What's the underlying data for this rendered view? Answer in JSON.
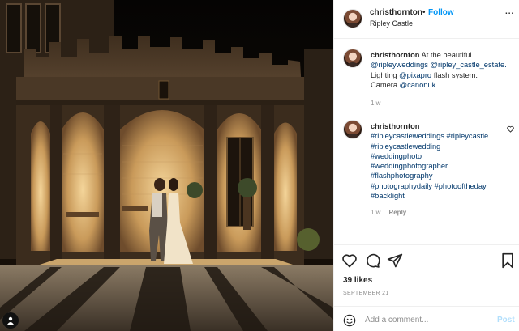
{
  "post": {
    "username": "christhornton",
    "follow_separator": "•",
    "follow_label": "Follow",
    "location": "Ripley Castle",
    "more_label": "..."
  },
  "caption": {
    "username": "christhornton",
    "text_before": " At the beautiful",
    "tags": [
      "@ripleyweddings",
      "@ripley_castle_estate."
    ],
    "text_lighting": "Lighting",
    "pixapro": "@pixapro",
    "text_flash": "flash system.",
    "text_camera": "Camera",
    "canon": "@canonuk",
    "time": "1 w"
  },
  "comment": {
    "username": "christhornton",
    "hashtags": [
      "#ripleycastleweddings #ripleycastle",
      "#ripleycastlewedding",
      "#weddingphoto",
      "#weddingphotographer",
      "#flashphotography",
      "#photographydaily #photooftheday",
      "#backlight"
    ],
    "time": "1 w",
    "reply_label": "Reply"
  },
  "stats": {
    "likes": "39 likes",
    "date": "SEPTEMBER 21"
  },
  "add_comment": {
    "placeholder": "Add a comment...",
    "post_label": "Post"
  },
  "icons": {
    "like": "heart-icon",
    "comment": "comment-icon",
    "share": "share-icon",
    "save": "bookmark-icon",
    "emoji": "emoji-icon",
    "user_tags": "user-tag-icon"
  },
  "colors": {
    "link": "#00376b",
    "follow": "#0095f6",
    "post_disabled": "#b2dffc",
    "muted": "#8e8e8e"
  }
}
